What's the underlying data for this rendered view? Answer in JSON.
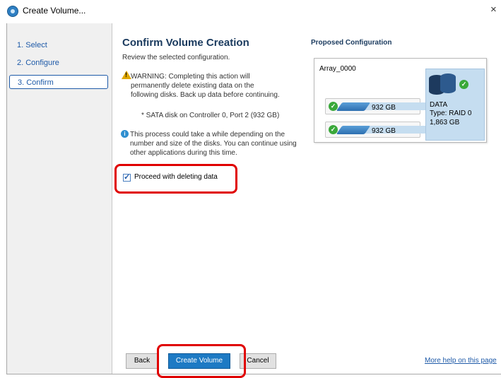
{
  "window": {
    "title": "Create Volume...",
    "close_glyph": "×"
  },
  "sidebar": {
    "items": [
      {
        "label": "1. Select"
      },
      {
        "label": "2. Configure"
      },
      {
        "label": "3. Confirm",
        "active": true
      }
    ]
  },
  "main": {
    "heading": "Confirm Volume Creation",
    "subtext": "Review the selected configuration.",
    "warning": "WARNING: Completing this action will permanently delete existing data on the following disks. Back up data before continuing.",
    "disk_line": "* SATA disk on Controller 0, Port 2 (932 GB)",
    "info": "This process could take a while depending on the number and size of the disks. You can continue using other applications during this time.",
    "checkbox": {
      "label": "Proceed with deleting data",
      "checked": true
    }
  },
  "proposed": {
    "title": "Proposed Configuration",
    "array_name": "Array_0000",
    "disks": [
      {
        "size": "932 GB"
      },
      {
        "size": "932 GB"
      }
    ],
    "volume": {
      "name": "DATA",
      "type": "Type: RAID 0",
      "size": "1,863 GB"
    }
  },
  "footer": {
    "back": "Back",
    "create": "Create Volume",
    "cancel": "Cancel",
    "help": "More help on this page"
  },
  "colors": {
    "accent": "#1d7ac4",
    "highlight": "#e00000",
    "panel": "#c5ddf0",
    "success": "#3aa83a",
    "warning": "#e0a800"
  }
}
